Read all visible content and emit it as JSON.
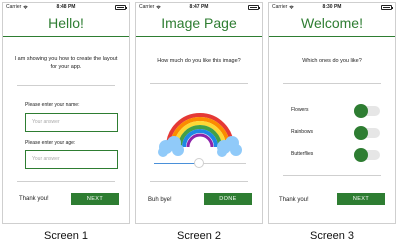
{
  "status_bar": {
    "carrier": "Carrier"
  },
  "screens": [
    {
      "time": "8:48 PM",
      "title": "Hello!",
      "intro": "I am showing you how to create the layout for your app.",
      "fields": [
        {
          "label": "Please enter your name:",
          "placeholder": "Your answer"
        },
        {
          "label": "Please enter your age:",
          "placeholder": "Your answer"
        }
      ],
      "footer_text": "Thank you!",
      "button": "NEXT",
      "caption": "Screen 1"
    },
    {
      "time": "8:47 PM",
      "title": "Image Page",
      "question": "How much do you like this image?",
      "image_icon": "rainbow-icon",
      "slider_value": 0.45,
      "footer_text": "Buh bye!",
      "button": "DONE",
      "caption": "Screen 2"
    },
    {
      "time": "8:30 PM",
      "title": "Welcome!",
      "question": "Which ones do you like?",
      "toggles": [
        {
          "label": "Flowers",
          "on": false
        },
        {
          "label": "Rainbows",
          "on": false
        },
        {
          "label": "Butterflies",
          "on": false
        }
      ],
      "footer_text": "Thank you!",
      "button": "NEXT",
      "caption": "Screen 3"
    }
  ],
  "colors": {
    "accent": "#2e7d32",
    "slider": "#4a90d9",
    "border": "#cfcfcf"
  }
}
